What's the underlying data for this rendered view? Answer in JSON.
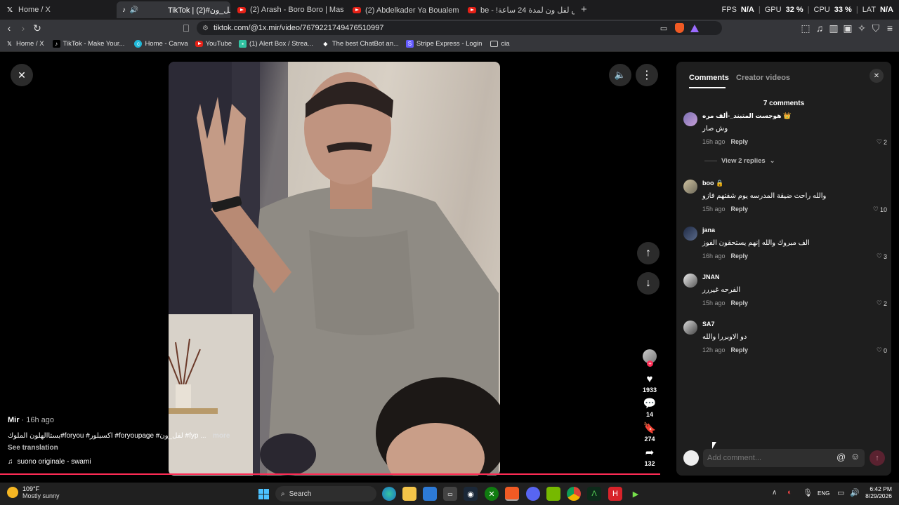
{
  "browser": {
    "tabs": [
      {
        "title": "Home / X"
      },
      {
        "title": "TikTok | لفل_ون#(2)"
      },
      {
        "title": "(2) Arash - Boro Boro | Masion Remix"
      },
      {
        "title": "(2) Abdelkader Ya Boualem - بوعلام"
      },
      {
        "title": "صرت رئيس لفل ون لمدة 24 ساعة! - be"
      }
    ],
    "stats": {
      "fps_label": "FPS",
      "fps": "N/A",
      "gpu_label": "GPU",
      "gpu": "32 %",
      "cpu_label": "CPU",
      "cpu": "33 %",
      "lat_label": "LAT",
      "lat": "N/A"
    },
    "url": "tiktok.com/@1x.mir/video/7679221749476510997",
    "bookmarks": [
      {
        "label": "Home / X",
        "icon": "x-icon"
      },
      {
        "label": "TikTok - Make Your...",
        "icon": "tiktok-icon"
      },
      {
        "label": "Home - Canva",
        "icon": "canva-icon"
      },
      {
        "label": "YouTube",
        "icon": "youtube-icon"
      },
      {
        "label": "(1) Alert Box / Strea...",
        "icon": "streamlabs-icon"
      },
      {
        "label": "The best ChatBot an...",
        "icon": "chatbot-icon"
      },
      {
        "label": "Stripe Express - Login",
        "icon": "stripe-icon"
      },
      {
        "label": "cia",
        "icon": "folder-icon"
      }
    ]
  },
  "video": {
    "author": "Mir",
    "time": " · 16h ago",
    "caption": "بستاالهلون الملوك#foryou #اكسبلور #foryoupage #لفل_ون #fyp ...",
    "more": "more",
    "see_translation": "See translation",
    "sound": "suono originale - swami",
    "likes": "1933",
    "comments": "14",
    "saves": "274",
    "shares": "132"
  },
  "panel": {
    "tab_comments": "Comments",
    "tab_creator": "Creator videos",
    "count": "7 comments",
    "view_replies": "View 2 replies",
    "reply_label": "Reply",
    "add_placeholder": "Add comment...",
    "comments": [
      {
        "name": "هوجست المتبند_-ألف مره 👑",
        "text": "وش صار",
        "time": "16h ago",
        "likes": "2"
      },
      {
        "name": "boo 🔒",
        "text": "والله راحت ضيقة المدرسه يوم شفتهم فازو",
        "time": "15h ago",
        "likes": "10"
      },
      {
        "name": "jana",
        "text": "الف مبروك والله إنهم يستحقون الفوز",
        "time": "16h ago",
        "likes": "3"
      },
      {
        "name": "JNAN",
        "text": "الفرحه غيررر",
        "time": "15h ago",
        "likes": "2"
      },
      {
        "name": "SA7",
        "text": "دو الاوبررا والله",
        "time": "12h ago",
        "likes": "0"
      }
    ]
  },
  "taskbar": {
    "weather_temp": "109°F",
    "weather_desc": "Mostly sunny",
    "search": "Search",
    "lang": "ENG",
    "time": "6:42 PM",
    "date": "8/29/2026"
  }
}
